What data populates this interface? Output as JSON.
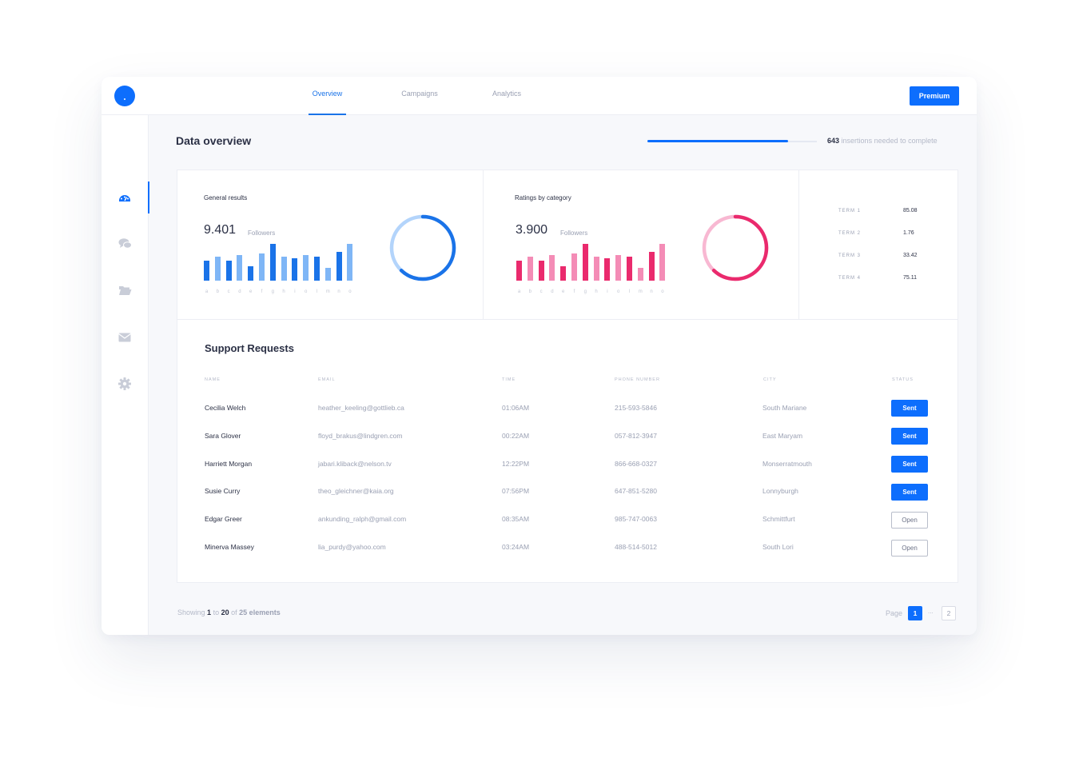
{
  "nav": {
    "tabs": [
      {
        "label": "Overview",
        "active": true
      },
      {
        "label": "Campaigns",
        "active": false
      },
      {
        "label": "Analytics",
        "active": false
      }
    ],
    "premium_label": "Premium"
  },
  "sidebar": {
    "items": [
      {
        "icon": "dashboard-icon",
        "active": true
      },
      {
        "icon": "chat-icon",
        "active": false
      },
      {
        "icon": "folder-icon",
        "active": false
      },
      {
        "icon": "mail-icon",
        "active": false
      },
      {
        "icon": "gear-icon",
        "active": false
      }
    ]
  },
  "header": {
    "title": "Data overview",
    "progress_fraction": 0.83,
    "progress_count": "643",
    "progress_text": "insertions needed to complete"
  },
  "general": {
    "title": "General results",
    "value": "9.401",
    "sub_label": "Followers",
    "bar_values": [
      0.55,
      0.65,
      0.55,
      0.7,
      0.4,
      0.75,
      1.0,
      0.65,
      0.6,
      0.7,
      0.65,
      0.35,
      0.78,
      1.0
    ],
    "bar_labels": [
      "a",
      "b",
      "c",
      "d",
      "e",
      "f",
      "g",
      "h",
      "i",
      "o",
      "l",
      "m",
      "n",
      "o"
    ],
    "donut_fraction": 0.62,
    "colors": {
      "dark": "#1a73e8",
      "light": "#7fb6f6",
      "ring_base": "#b3d4fb"
    }
  },
  "ratings": {
    "title": "Ratings by category",
    "value": "3.900",
    "sub_label": "Followers",
    "bar_values": [
      0.55,
      0.65,
      0.55,
      0.7,
      0.4,
      0.75,
      1.0,
      0.65,
      0.6,
      0.7,
      0.65,
      0.35,
      0.78,
      1.0
    ],
    "bar_labels": [
      "a",
      "b",
      "c",
      "d",
      "e",
      "f",
      "g",
      "h",
      "i",
      "o",
      "l",
      "m",
      "n",
      "o"
    ],
    "donut_fraction": 0.62,
    "colors": {
      "dark": "#ea2a6d",
      "light": "#f48cb6",
      "ring_base": "#f8b8d2"
    }
  },
  "terms": [
    {
      "label": "TERM 1",
      "value": "85.08"
    },
    {
      "label": "TERM 2",
      "value": "1.76"
    },
    {
      "label": "TERM 3",
      "value": "33.42"
    },
    {
      "label": "TERM 4",
      "value": "75.11"
    }
  ],
  "support": {
    "title": "Support Requests",
    "columns": [
      "NAME",
      "EMAIL",
      "TIME",
      "PHONE NUMBER",
      "CITY",
      "STATUS"
    ],
    "rows": [
      {
        "name": "Cecilia Welch",
        "email": "heather_keeling@gottlieb.ca",
        "time": "01:06AM",
        "phone": "215-593-5846",
        "city": "South Mariane",
        "status": "Sent"
      },
      {
        "name": "Sara Glover",
        "email": "floyd_brakus@lindgren.com",
        "time": "00:22AM",
        "phone": "057-812-3947",
        "city": "East Maryam",
        "status": "Sent"
      },
      {
        "name": "Harriett Morgan",
        "email": "jabari.kliback@nelson.tv",
        "time": "12:22PM",
        "phone": "866-668-0327",
        "city": "Monserratmouth",
        "status": "Sent"
      },
      {
        "name": "Susie Curry",
        "email": "theo_gleichner@kaia.org",
        "time": "07:56PM",
        "phone": "647-851-5280",
        "city": "Lonnyburgh",
        "status": "Sent"
      },
      {
        "name": "Edgar Greer",
        "email": "ankunding_ralph@gmail.com",
        "time": "08:35AM",
        "phone": "985-747-0063",
        "city": "Schmittfurt",
        "status": "Open"
      },
      {
        "name": "Minerva Massey",
        "email": "lia_purdy@yahoo.com",
        "time": "03:24AM",
        "phone": "488-514-5012",
        "city": "South Lori",
        "status": "Open"
      }
    ]
  },
  "footer": {
    "showing": "Showing",
    "from": "1",
    "to_word": "to",
    "to": "20",
    "of_word": "of",
    "total": "25 elements",
    "page_label": "Page",
    "current_page": "1",
    "ellipsis": "...",
    "next_page": "2"
  }
}
